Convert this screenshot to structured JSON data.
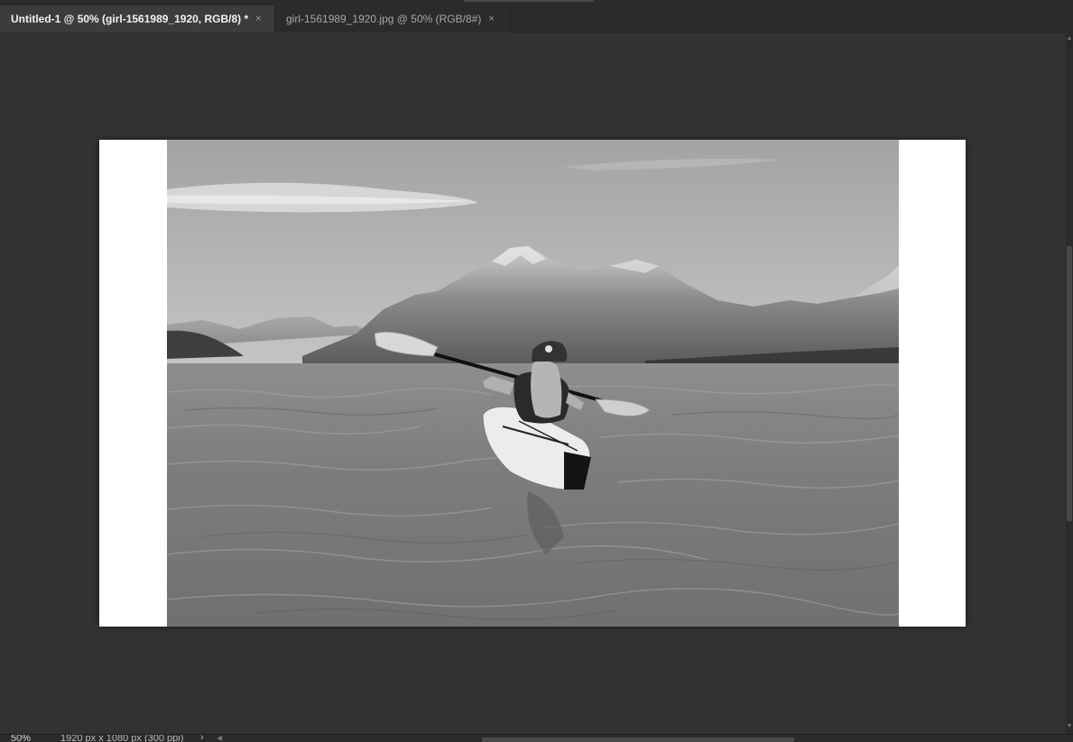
{
  "tabs": [
    {
      "title": "Untitled-1 @ 50% (girl-1561989_1920, RGB/8) *",
      "close": "×",
      "active": true
    },
    {
      "title": "girl-1561989_1920.jpg @ 50% (RGB/8#)",
      "close": "×",
      "active": false
    }
  ],
  "status": {
    "zoom": "50%",
    "doc_info": "1920 px x 1080 px (300 ppi)",
    "arrow": "›"
  },
  "scroll": {
    "up": "▲",
    "down": "▼",
    "left": "◀"
  },
  "colors": {
    "workspace": "#323232",
    "active_tab": "#3c3c3c",
    "inactive_tab": "#2b2b2b",
    "document": "#ffffff"
  }
}
